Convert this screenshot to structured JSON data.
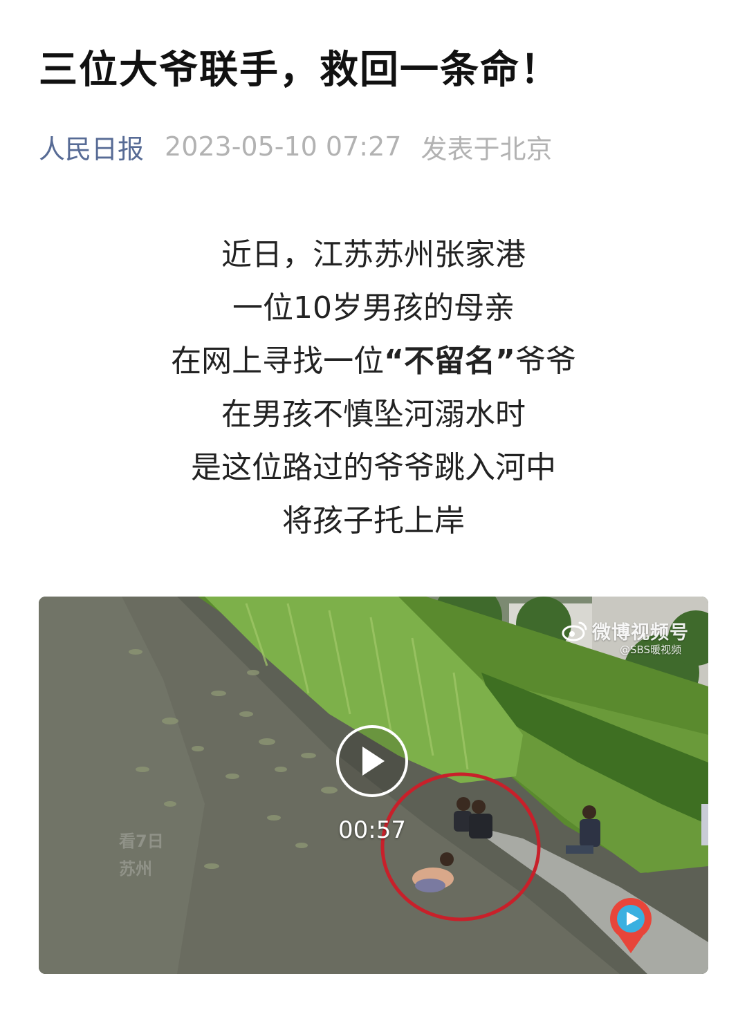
{
  "article": {
    "title": "三位大爷联手，救回一条命！",
    "source": "人民日报",
    "date": "2023-05-10 07:27",
    "location": "发表于北京"
  },
  "intro": {
    "line1": "近日，江苏苏州张家港",
    "line2": "一位10岁男孩的母亲",
    "line3_pre": "在网上寻找一位",
    "line3_bold": "“不留名”",
    "line3_post": "爷爷",
    "line4": "在男孩不慎坠河溺水时",
    "line5": "是这位路过的爷爷跳入河中",
    "line6": "将孩子托上岸"
  },
  "video": {
    "duration": "00:57",
    "watermark": "微博视频号",
    "watermark_sub": "@SBS暖视频",
    "faint_logo_line1": "看7日",
    "faint_logo_line2": "苏州",
    "icons": {
      "play": "play-icon",
      "weibo": "weibo-logo-icon",
      "mascot": "mascot-icon"
    },
    "highlight_color": "#c8202a"
  }
}
